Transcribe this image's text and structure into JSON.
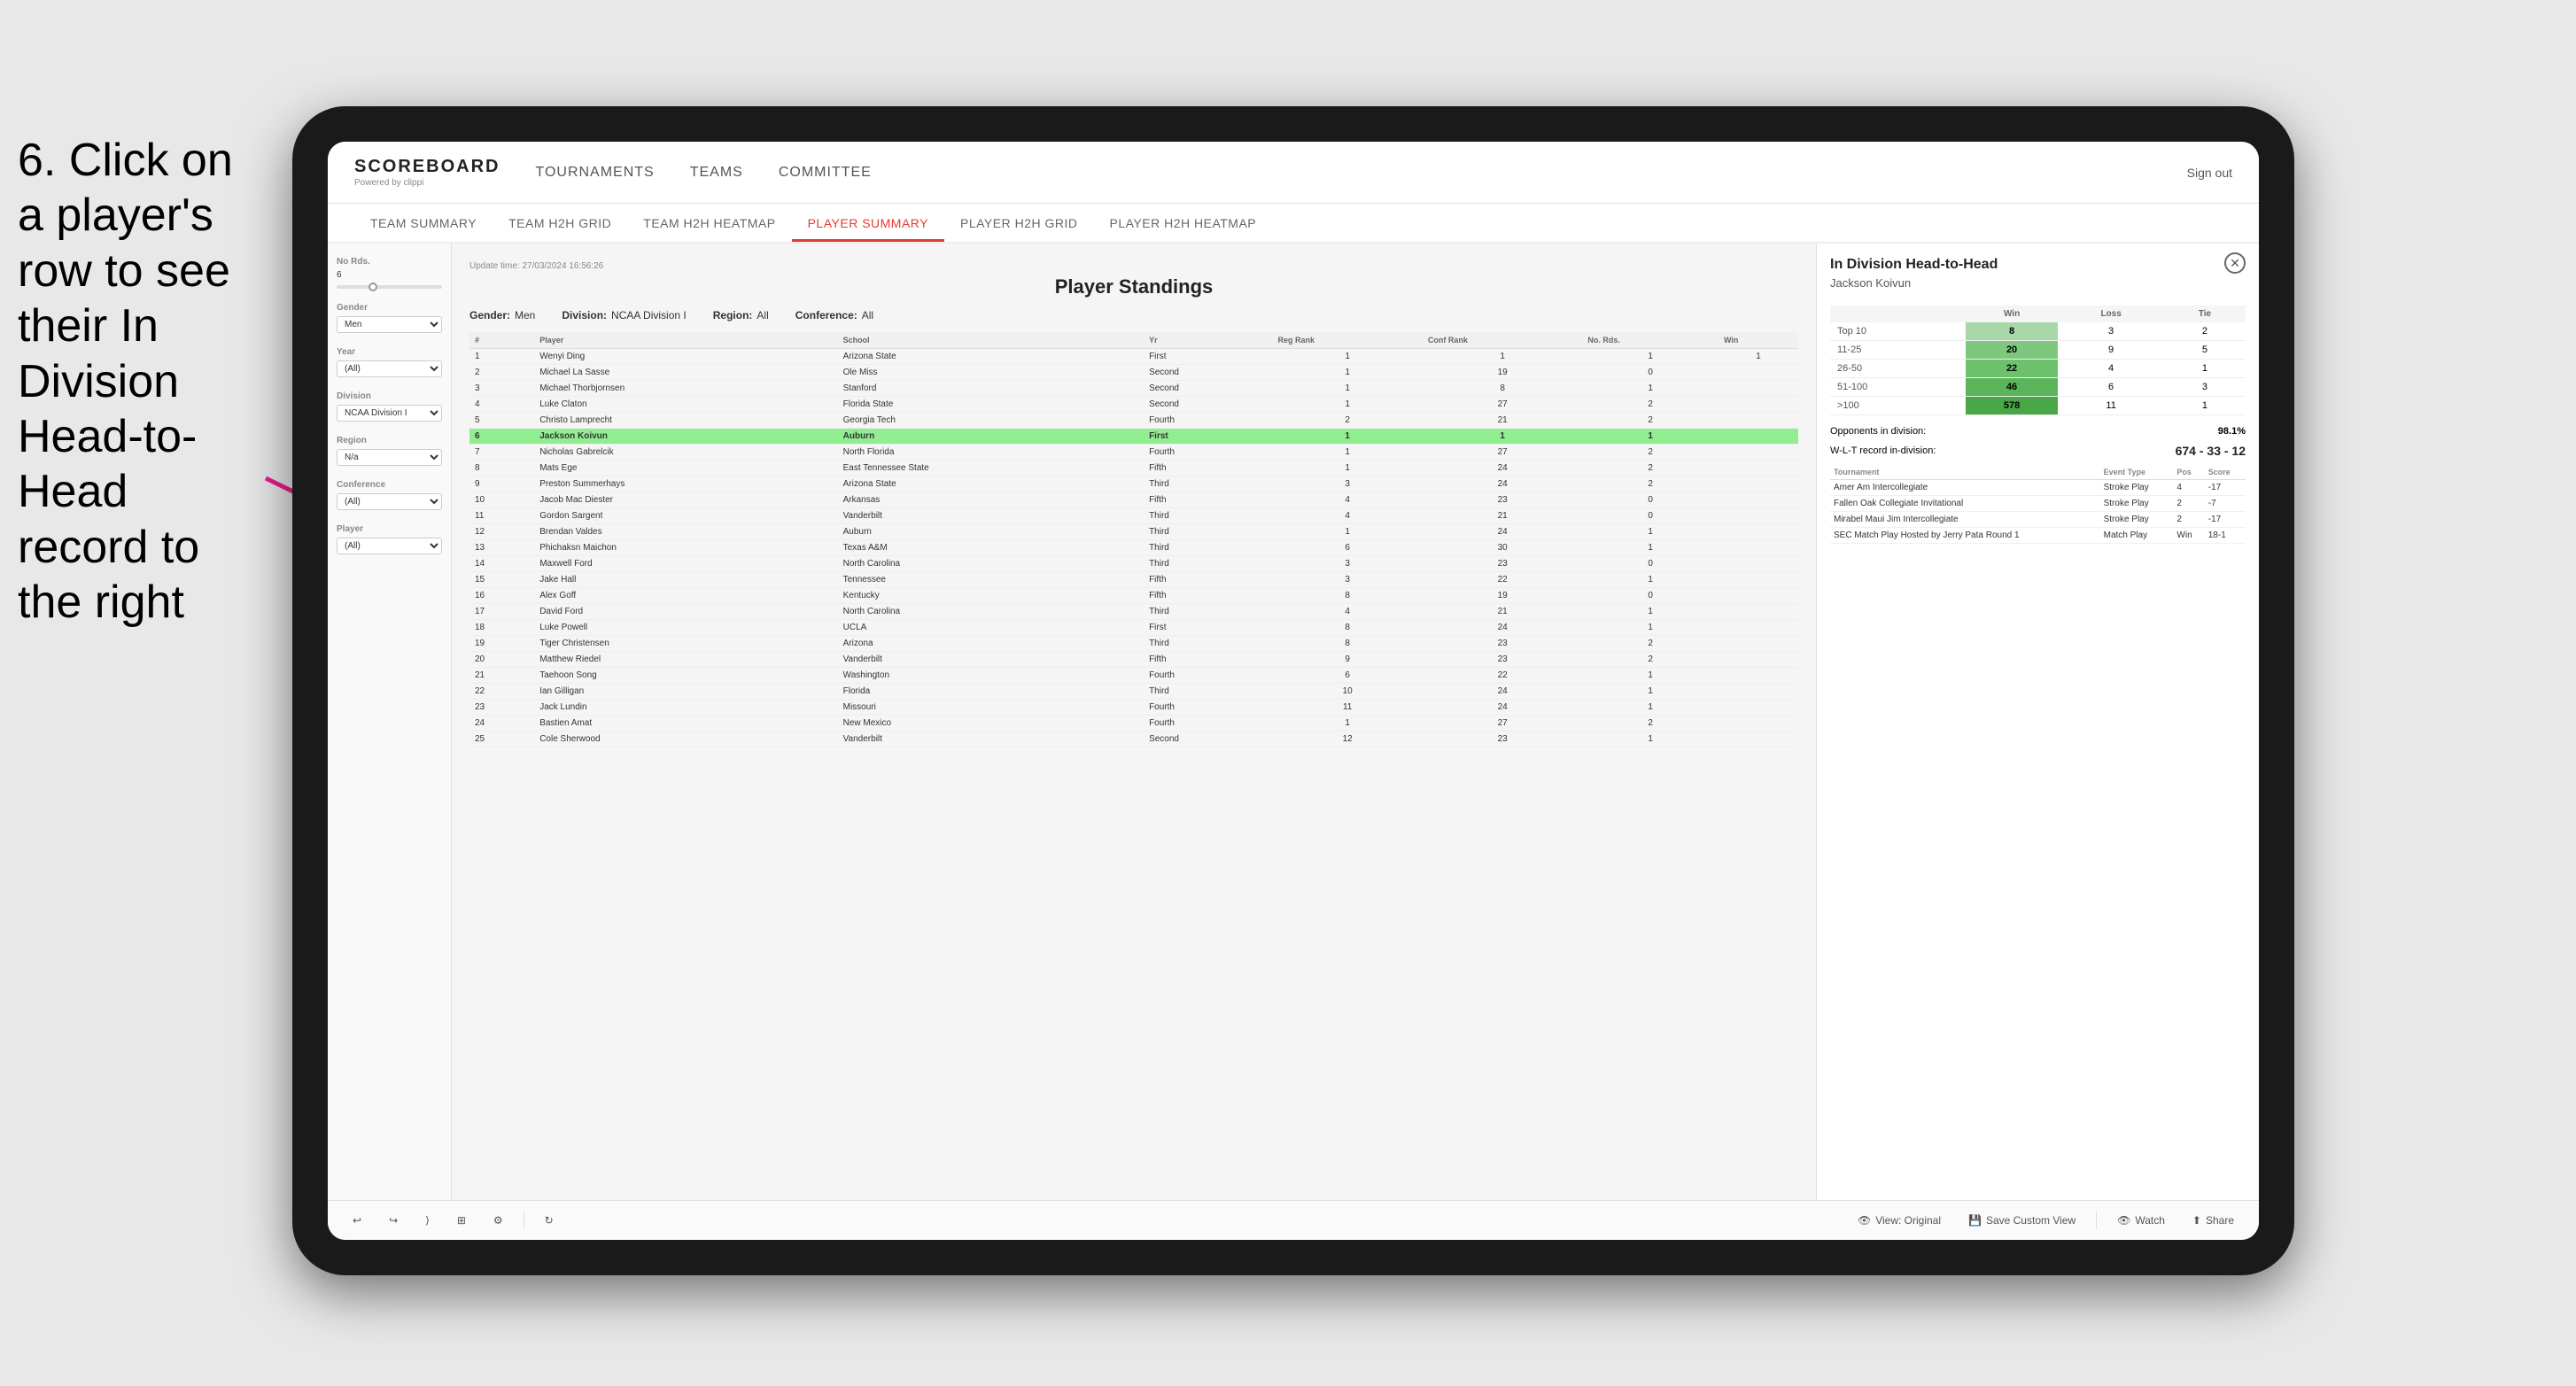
{
  "instruction": {
    "text": "6. Click on a player's row to see their In Division Head-to-Head record to the right"
  },
  "nav": {
    "logo": "SCOREBOARD",
    "logo_sub": "Powered by clippi",
    "items": [
      "TOURNAMENTS",
      "TEAMS",
      "COMMITTEE"
    ],
    "sign_out": "Sign out"
  },
  "sub_nav": {
    "items": [
      "TEAM SUMMARY",
      "TEAM H2H GRID",
      "TEAM H2H HEATMAP",
      "PLAYER SUMMARY",
      "PLAYER H2H GRID",
      "PLAYER H2H HEATMAP"
    ],
    "active": "PLAYER SUMMARY"
  },
  "sidebar": {
    "no_rds_label": "No Rds.",
    "no_rds_value": "6",
    "gender_label": "Gender",
    "gender_value": "Men",
    "year_label": "Year",
    "year_value": "(All)",
    "division_label": "Division",
    "division_value": "NCAA Division I",
    "region_label": "Region",
    "region_value": "N/a",
    "conference_label": "Conference",
    "conference_value": "(All)",
    "player_label": "Player",
    "player_value": "(All)"
  },
  "standings": {
    "update_time": "Update time:",
    "update_date": "27/03/2024 16:56:26",
    "title": "Player Standings",
    "gender": "Men",
    "division": "NCAA Division I",
    "region": "All",
    "conference": "All",
    "columns": [
      "#",
      "Player",
      "School",
      "Yr",
      "Reg Rank",
      "Conf Rank",
      "No. Rds.",
      "Win"
    ],
    "rows": [
      {
        "num": "1",
        "player": "Wenyi Ding",
        "school": "Arizona State",
        "yr": "First",
        "reg": "1",
        "conf": "1",
        "rds": "1",
        "win": "1"
      },
      {
        "num": "2",
        "player": "Michael La Sasse",
        "school": "Ole Miss",
        "yr": "Second",
        "reg": "1",
        "conf": "19",
        "rds": "0"
      },
      {
        "num": "3",
        "player": "Michael Thorbjornsen",
        "school": "Stanford",
        "yr": "Second",
        "reg": "1",
        "conf": "8",
        "rds": "1"
      },
      {
        "num": "4",
        "player": "Luke Claton",
        "school": "Florida State",
        "yr": "Second",
        "reg": "1",
        "conf": "27",
        "rds": "2"
      },
      {
        "num": "5",
        "player": "Christo Lamprecht",
        "school": "Georgia Tech",
        "yr": "Fourth",
        "reg": "2",
        "conf": "21",
        "rds": "2"
      },
      {
        "num": "6",
        "player": "Jackson Koivun",
        "school": "Auburn",
        "yr": "First",
        "reg": "1",
        "conf": "1",
        "rds": "1",
        "highlighted": true
      },
      {
        "num": "7",
        "player": "Nicholas Gabrelcik",
        "school": "North Florida",
        "yr": "Fourth",
        "reg": "1",
        "conf": "27",
        "rds": "2"
      },
      {
        "num": "8",
        "player": "Mats Ege",
        "school": "East Tennessee State",
        "yr": "Fifth",
        "reg": "1",
        "conf": "24",
        "rds": "2"
      },
      {
        "num": "9",
        "player": "Preston Summerhays",
        "school": "Arizona State",
        "yr": "Third",
        "reg": "3",
        "conf": "24",
        "rds": "2"
      },
      {
        "num": "10",
        "player": "Jacob Mac Diester",
        "school": "Arkansas",
        "yr": "Fifth",
        "reg": "4",
        "conf": "23",
        "rds": "0"
      },
      {
        "num": "11",
        "player": "Gordon Sargent",
        "school": "Vanderbilt",
        "yr": "Third",
        "reg": "4",
        "conf": "21",
        "rds": "0"
      },
      {
        "num": "12",
        "player": "Brendan Valdes",
        "school": "Auburn",
        "yr": "Third",
        "reg": "1",
        "conf": "24",
        "rds": "1"
      },
      {
        "num": "13",
        "player": "Phichaksn Maichon",
        "school": "Texas A&M",
        "yr": "Third",
        "reg": "6",
        "conf": "30",
        "rds": "1"
      },
      {
        "num": "14",
        "player": "Maxwell Ford",
        "school": "North Carolina",
        "yr": "Third",
        "reg": "3",
        "conf": "23",
        "rds": "0"
      },
      {
        "num": "15",
        "player": "Jake Hall",
        "school": "Tennessee",
        "yr": "Fifth",
        "reg": "3",
        "conf": "22",
        "rds": "1"
      },
      {
        "num": "16",
        "player": "Alex Goff",
        "school": "Kentucky",
        "yr": "Fifth",
        "reg": "8",
        "conf": "19",
        "rds": "0"
      },
      {
        "num": "17",
        "player": "David Ford",
        "school": "North Carolina",
        "yr": "Third",
        "reg": "4",
        "conf": "21",
        "rds": "1"
      },
      {
        "num": "18",
        "player": "Luke Powell",
        "school": "UCLA",
        "yr": "First",
        "reg": "8",
        "conf": "24",
        "rds": "1"
      },
      {
        "num": "19",
        "player": "Tiger Christensen",
        "school": "Arizona",
        "yr": "Third",
        "reg": "8",
        "conf": "23",
        "rds": "2"
      },
      {
        "num": "20",
        "player": "Matthew Riedel",
        "school": "Vanderbilt",
        "yr": "Fifth",
        "reg": "9",
        "conf": "23",
        "rds": "2"
      },
      {
        "num": "21",
        "player": "Taehoon Song",
        "school": "Washington",
        "yr": "Fourth",
        "reg": "6",
        "conf": "22",
        "rds": "1"
      },
      {
        "num": "22",
        "player": "Ian Gilligan",
        "school": "Florida",
        "yr": "Third",
        "reg": "10",
        "conf": "24",
        "rds": "1"
      },
      {
        "num": "23",
        "player": "Jack Lundin",
        "school": "Missouri",
        "yr": "Fourth",
        "reg": "11",
        "conf": "24",
        "rds": "1"
      },
      {
        "num": "24",
        "player": "Bastien Amat",
        "school": "New Mexico",
        "yr": "Fourth",
        "reg": "1",
        "conf": "27",
        "rds": "2"
      },
      {
        "num": "25",
        "player": "Cole Sherwood",
        "school": "Vanderbilt",
        "yr": "Second",
        "reg": "12",
        "conf": "23",
        "rds": "1"
      }
    ]
  },
  "h2h": {
    "title": "In Division Head-to-Head",
    "player": "Jackson Koivun",
    "columns": [
      "",
      "Win",
      "Loss",
      "Tie"
    ],
    "rows": [
      {
        "label": "Top 10",
        "win": "8",
        "loss": "3",
        "tie": "2"
      },
      {
        "label": "11-25",
        "win": "20",
        "loss": "9",
        "tie": "5"
      },
      {
        "label": "26-50",
        "win": "22",
        "loss": "4",
        "tie": "1"
      },
      {
        "label": "51-100",
        "win": "46",
        "loss": "6",
        "tie": "3"
      },
      {
        "label": ">100",
        "win": "578",
        "loss": "11",
        "tie": "1"
      }
    ],
    "opponents_label": "Opponents in division:",
    "opponents_pct": "98.1%",
    "wlt_label": "W-L-T record in-division:",
    "wlt": "674 - 33 - 12",
    "tournament_cols": [
      "Tournament",
      "Event Type",
      "Pos",
      "Score"
    ],
    "tournaments": [
      {
        "name": "Amer Am Intercollegiate",
        "type": "Stroke Play",
        "pos": "4",
        "score": "-17"
      },
      {
        "name": "Fallen Oak Collegiate Invitational",
        "type": "Stroke Play",
        "pos": "2",
        "score": "-7"
      },
      {
        "name": "Mirabel Maui Jim Intercollegiate",
        "type": "Stroke Play",
        "pos": "2",
        "score": "-17"
      },
      {
        "name": "SEC Match Play Hosted by Jerry Pata Round 1",
        "type": "Match Play",
        "pos": "Win",
        "score": "18-1"
      }
    ]
  },
  "toolbar": {
    "undo": "↩",
    "redo": "↪",
    "forward": "⟩",
    "view_original": "View: Original",
    "save_custom": "Save Custom View",
    "watch": "Watch",
    "share": "Share"
  },
  "colors": {
    "accent": "#e53935",
    "highlight_green": "#90EE90",
    "win_green": "#6DC16D"
  }
}
